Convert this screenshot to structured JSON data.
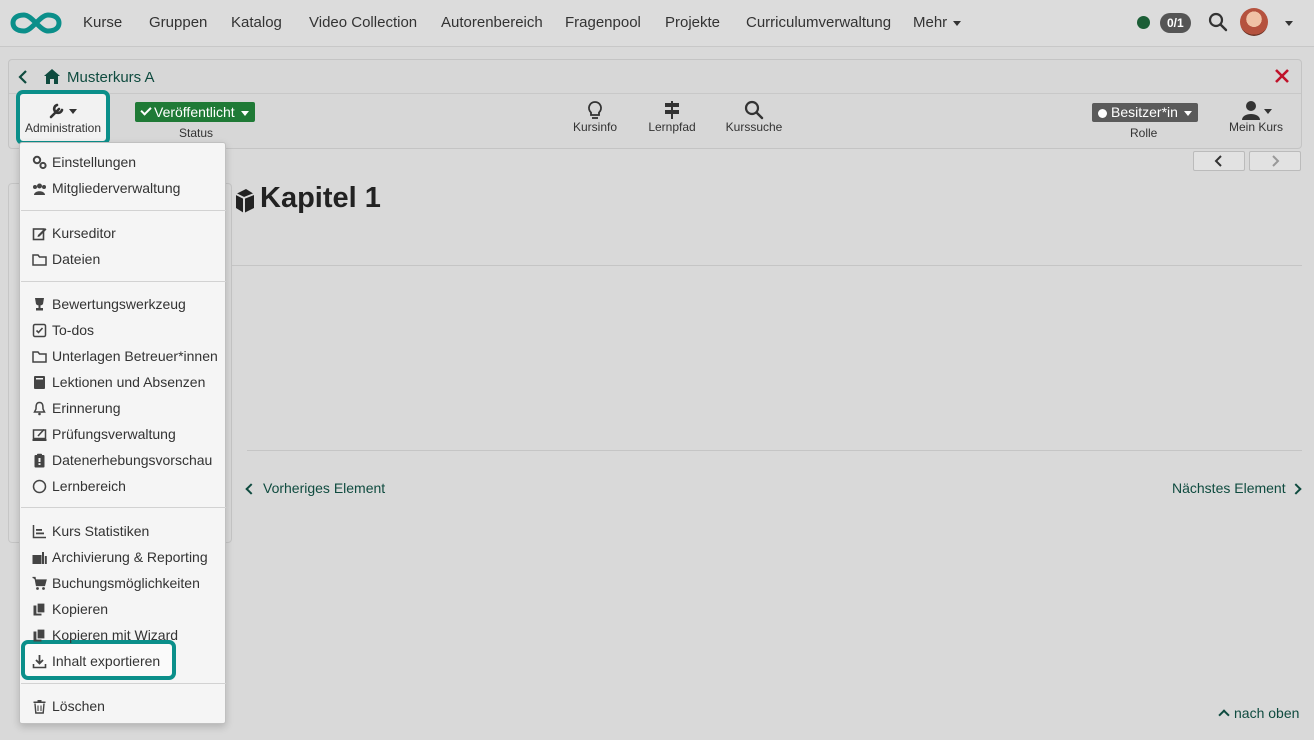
{
  "nav": {
    "items": [
      "Kurse",
      "Gruppen",
      "Katalog",
      "Video Collection",
      "Autorenbereich",
      "Fragenpool",
      "Projekte",
      "Curriculumverwaltung",
      "Mehr"
    ],
    "badge": "0/1",
    "colors": {
      "brand": "#0b8f8a",
      "status_online": "#1b5e36"
    }
  },
  "course": {
    "title": "Musterkurs A",
    "admin_label": "Administration",
    "status_value": "Veröffentlicht",
    "status_label": "Status",
    "tools": [
      "Kursinfo",
      "Lernpfad",
      "Kurssuche"
    ],
    "role_value": "Besitzer*in",
    "role_label": "Rolle",
    "my_course_label": "Mein Kurs"
  },
  "content": {
    "chapter_title": "Kapitel 1",
    "prev": "Vorheriges Element",
    "next": "Nächstes Element",
    "to_top": "nach oben"
  },
  "menu": {
    "groups": [
      [
        "Einstellungen",
        "Mitgliederverwaltung"
      ],
      [
        "Kurseditor",
        "Dateien"
      ],
      [
        "Bewertungswerkzeug",
        "To-dos",
        "Unterlagen Betreuer*innen",
        "Lektionen und Absenzen",
        "Erinnerung",
        "Prüfungsverwaltung",
        "Datenerhebungsvorschau",
        "Lernbereich"
      ],
      [
        "Kurs Statistiken",
        "Archivierung & Reporting",
        "Buchungsmöglichkeiten",
        "Kopieren",
        "Kopieren mit Wizard",
        "Inhalt exportieren"
      ],
      [
        "Löschen"
      ]
    ],
    "highlighted": "Inhalt exportieren"
  }
}
